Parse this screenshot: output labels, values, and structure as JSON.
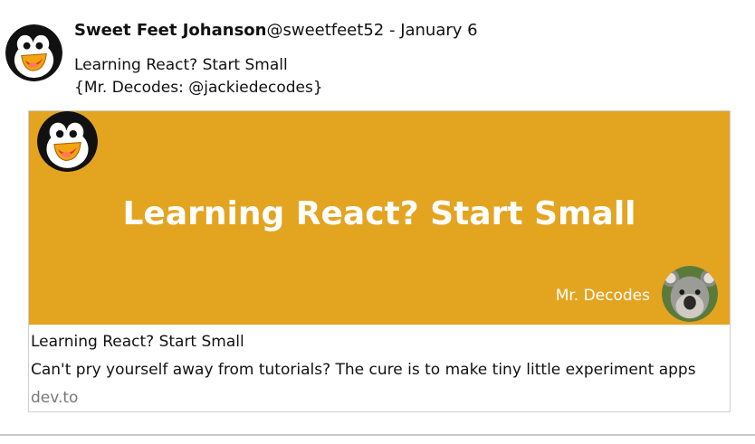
{
  "post": {
    "author_name": "Sweet Feet Johanson",
    "handle": "@sweetfeet52",
    "separator": " - ",
    "date": "January 6",
    "avatar_icon": "penguin-avatar-icon",
    "body_lines": [
      "Learning React? Start Small",
      "{Mr. Decodes: @jackiedecodes}"
    ]
  },
  "card": {
    "banner_logo_icon": "penguin-logo-icon",
    "banner_title": "Learning React? Start Small",
    "banner_author": "Mr. Decodes",
    "banner_author_avatar_icon": "koala-avatar-icon",
    "title": "Learning React? Start Small",
    "description": "Can't pry yourself away from tutorials? The cure is to make tiny little experiment apps",
    "domain": "dev.to"
  },
  "colors": {
    "banner_bg": "#e3a420",
    "domain_text": "#777777",
    "card_border": "#cfcfcf",
    "divider": "#c9c9c9"
  }
}
